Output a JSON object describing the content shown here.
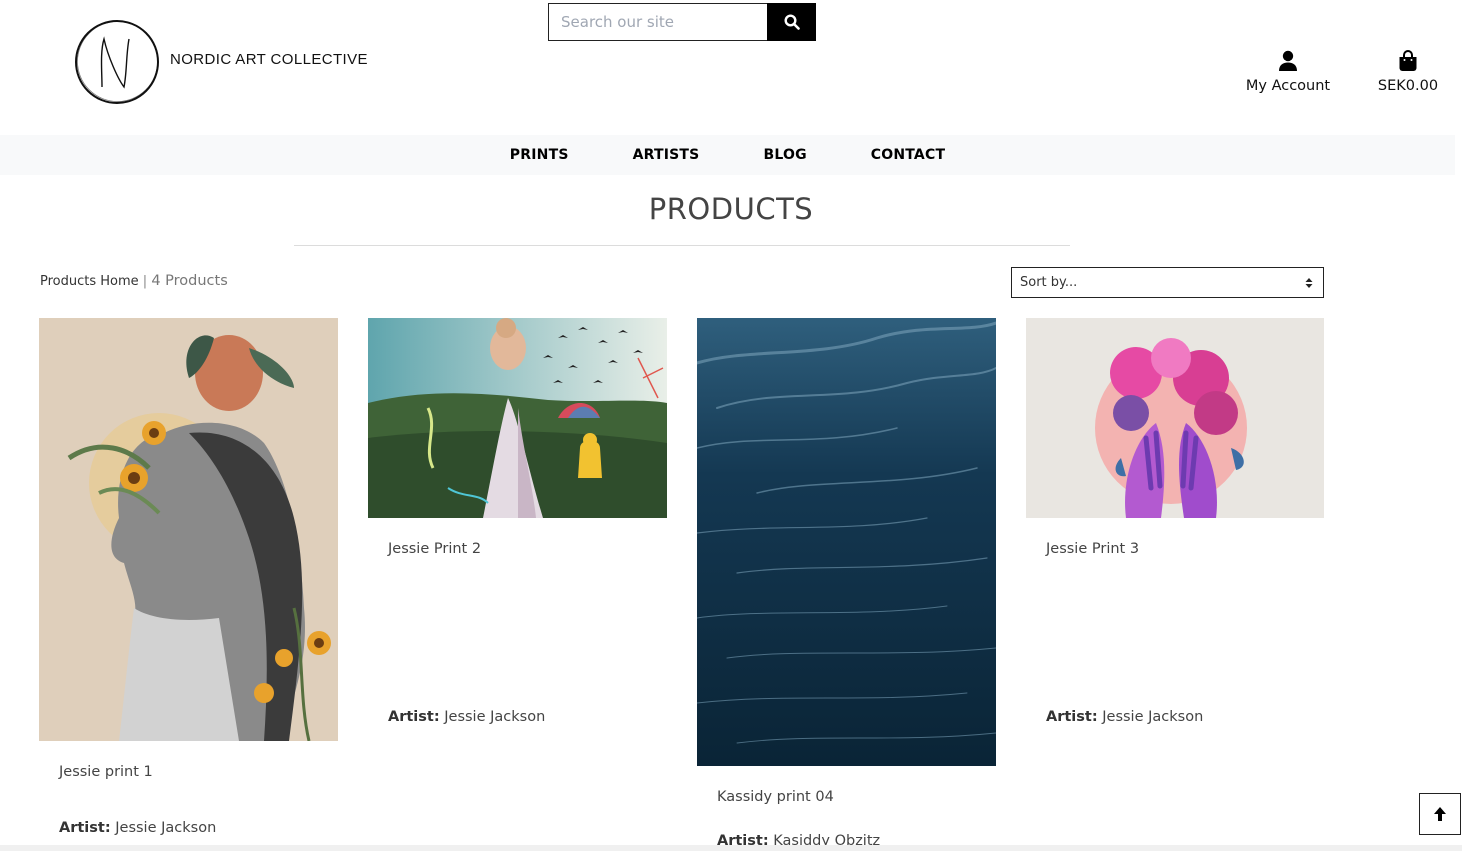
{
  "header": {
    "brand": "NORDIC ART COLLECTIVE",
    "logo_letter": "N",
    "search_placeholder": "Search our site",
    "account_label": "My Account",
    "cart_label": "SEK0.00"
  },
  "nav": {
    "items": [
      {
        "label": "PRINTS"
      },
      {
        "label": "ARTISTS"
      },
      {
        "label": "BLOG"
      },
      {
        "label": "CONTACT"
      }
    ]
  },
  "main": {
    "title": "PRODUCTS",
    "breadcrumb_home": "Products Home",
    "breadcrumb_separator": "|",
    "product_count": "4 Products",
    "sort_placeholder": "Sort by..."
  },
  "products": [
    {
      "name": "Jessie print 1",
      "artist_label": "Artist:",
      "artist": "Jessie Jackson",
      "image": "collage-woman-flowers"
    },
    {
      "name": "Jessie Print 2",
      "artist_label": "Artist:",
      "artist": "Jessie Jackson",
      "image": "collage-waterfall-children"
    },
    {
      "name": "Kassidy print 04",
      "artist_label": "Artist:",
      "artist": "Kasiddy Obzitz",
      "image": "dark-water-waves"
    },
    {
      "name": "Jessie Print 3",
      "artist_label": "Artist:",
      "artist": "Jessie Jackson",
      "image": "collage-pink-hands-flowers"
    }
  ],
  "icons": {
    "search": "search-icon",
    "account": "user-icon",
    "cart": "shopping-bag-icon",
    "sort": "sort-arrows-icon",
    "back_to_top": "arrow-up-icon"
  }
}
